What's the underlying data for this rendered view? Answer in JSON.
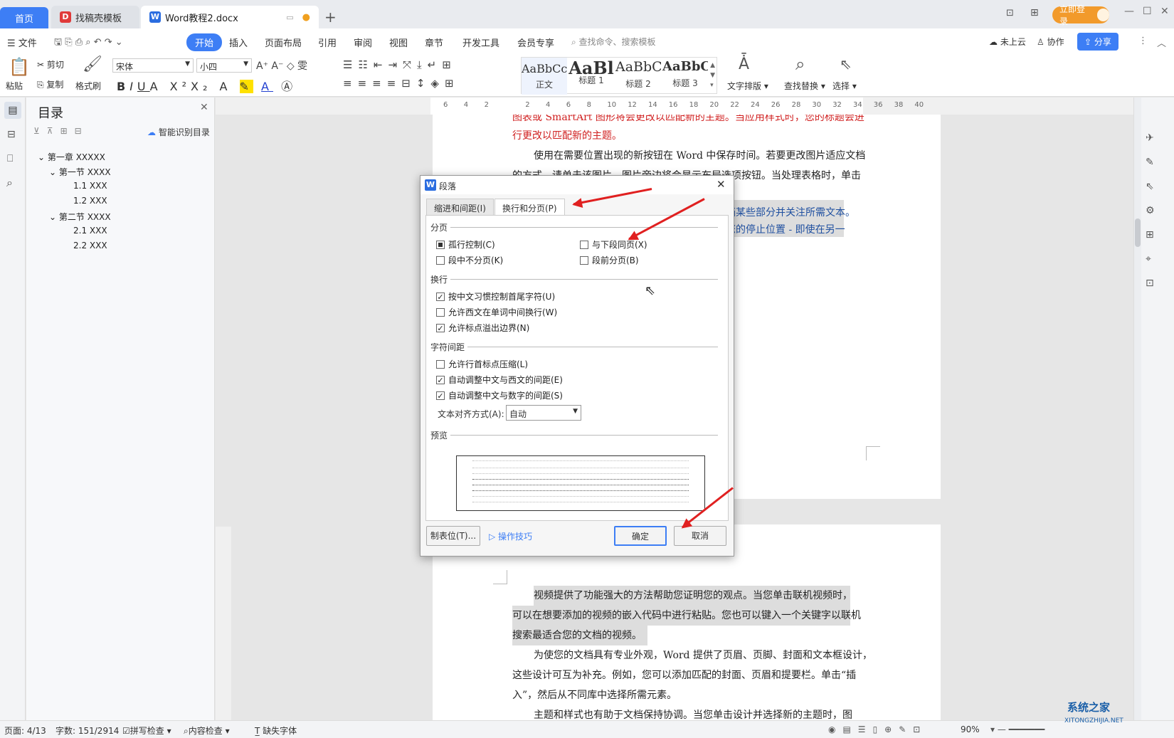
{
  "tabs": {
    "home": "首页",
    "template": "找稿壳模板",
    "doc": "Word教程2.docx"
  },
  "login": "立即登录",
  "menu": {
    "file": "文件",
    "start": "开始",
    "insert": "插入",
    "layout": "页面布局",
    "ref": "引用",
    "review": "审阅",
    "view": "视图",
    "chapter": "章节",
    "dev": "开发工具",
    "member": "会员专享",
    "search": "查找命令、搜索模板",
    "cloud": "未上云",
    "collab": "协作",
    "share": "分享"
  },
  "toolbar": {
    "paste": "粘贴",
    "cut": "剪切",
    "copy": "复制",
    "format_painter": "格式刷",
    "font": "宋体",
    "size": "小四",
    "layout_text": "文字排版",
    "find_replace": "查找替换",
    "select": "选择"
  },
  "styles": [
    {
      "sample": "AaBbCcI",
      "label": "正文"
    },
    {
      "sample": "AaBl",
      "label": "标题 1"
    },
    {
      "sample": "AaBbC",
      "label": "标题 2"
    },
    {
      "sample": "AaBbC",
      "label": "标题 3"
    }
  ],
  "toc": {
    "title": "目录",
    "smart": "智能识别目录",
    "items": [
      "第一章 XXXXX",
      "第一节 XXXX",
      "1.1 XXX",
      "1.2 XXX",
      "第二节 XXXX",
      "2.1 XXX",
      "2.2 XXX"
    ]
  },
  "doc": {
    "p1_red1": "图表或 SmartArt 图形将会更改以匹配新的主题。当应用样式时，您的标题会进",
    "p1_red2": "行更改以匹配新的主题。",
    "p2_1": "使用在需要位置出现的新按钮在 Word 中保存时间。若要更改图片适应文档",
    "p2_2": "的方式，请单击该图片，图片旁边将会显示布局选项按钮。当处理表格时，单击",
    "p3_1": "档某些部分并关注所需文本。",
    "p3_2": "您的停止位置 - 即使在另一",
    "p4_1": "视频提供了功能强大的方法帮助您证明您的观点。当您单击联机视频时，",
    "p4_2": "可以在想要添加的视频的嵌入代码中进行粘贴。您也可以键入一个关键字以联机",
    "p4_3": "搜索最适合您的文档的视频。",
    "p5_1": "为使您的文档具有专业外观，Word 提供了页眉、页脚、封面和文本框设计，",
    "p5_2": "这些设计可互为补充。例如，您可以添加匹配的封面、页眉和提要栏。单击“插",
    "p5_3": "入”，然后从不同库中选择所需元素。",
    "p6_1": "主题和样式也有助于文档保持协调。当您单击设计并选择新的主题时，图"
  },
  "ruler": [
    "6",
    "4",
    "2",
    "",
    "2",
    "4",
    "6",
    "8",
    "10",
    "12",
    "14",
    "16",
    "18",
    "20",
    "22",
    "24",
    "26",
    "28",
    "30",
    "32",
    "34",
    "36",
    "38",
    "40"
  ],
  "dialog": {
    "title": "段落",
    "tab1": "缩进和间距(I)",
    "tab2": "换行和分页(P)",
    "sec_page": "分页",
    "widow": "孤行控制(C)",
    "keep_next": "与下段同页(X)",
    "keep_lines": "段中不分页(K)",
    "page_before": "段前分页(B)",
    "sec_wrap": "换行",
    "cjk_rules": "按中文习惯控制首尾字符(U)",
    "word_wrap": "允许西文在单词中间换行(W)",
    "punct_overflow": "允许标点溢出边界(N)",
    "sec_spacing": "字符间距",
    "compress": "允许行首标点压缩(L)",
    "auto_cjk_latin": "自动调整中文与西文的间距(E)",
    "auto_cjk_num": "自动调整中文与数字的间距(S)",
    "align_label": "文本对齐方式(A):",
    "align_value": "自动",
    "sec_preview": "预览",
    "tabs_btn": "制表位(T)...",
    "tips": "操作技巧",
    "ok": "确定",
    "cancel": "取消"
  },
  "status": {
    "page": "页面: 4/13",
    "words": "字数: 151/2914",
    "spell": "拼写检查",
    "content": "内容检查",
    "font_missing": "缺失字体",
    "zoom": "90%"
  },
  "watermark": {
    "brand": "系统之家",
    "url": "XITONGZHIJIA.NET"
  }
}
